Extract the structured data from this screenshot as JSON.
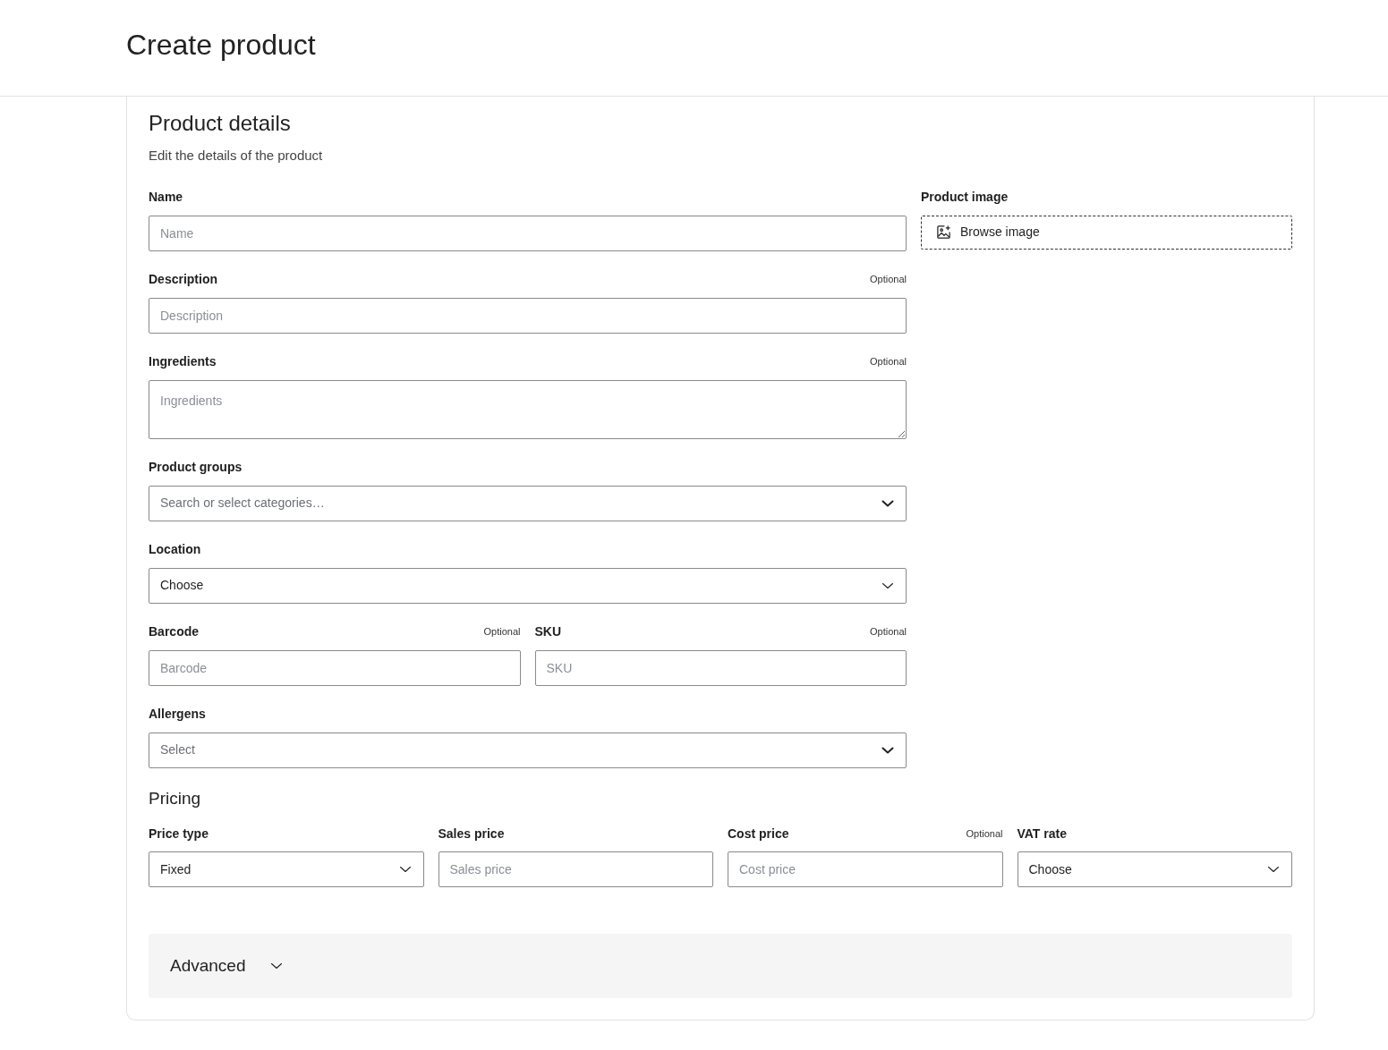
{
  "page": {
    "title": "Create product"
  },
  "section": {
    "title": "Product details",
    "subtitle": "Edit the details of the product"
  },
  "fields": [
    {
      "kind": "text",
      "label": "Name",
      "placeholder": "Name"
    },
    {
      "kind": "text",
      "label": "Description",
      "optional": "Optional",
      "placeholder": "Description"
    },
    {
      "kind": "textarea",
      "label": "Ingredients",
      "optional": "Optional",
      "placeholder": "Ingredients"
    },
    {
      "kind": "combobox",
      "label": "Product groups",
      "placeholder": "Search or select categories…"
    },
    {
      "kind": "select",
      "label": "Location",
      "value": "Choose"
    },
    {
      "kind": "pair",
      "items": [
        {
          "kind": "text",
          "label": "Barcode",
          "optional": "Optional",
          "placeholder": "Barcode"
        },
        {
          "kind": "text",
          "label": "SKU",
          "optional": "Optional",
          "placeholder": "SKU"
        }
      ]
    },
    {
      "kind": "combobox",
      "label": "Allergens",
      "placeholder": "Select"
    }
  ],
  "product_image": {
    "label": "Product image",
    "button": "Browse image"
  },
  "pricing": {
    "title": "Pricing",
    "fields": [
      {
        "kind": "select",
        "label": "Price type",
        "value": "Fixed"
      },
      {
        "kind": "text",
        "label": "Sales price",
        "placeholder": "Sales price"
      },
      {
        "kind": "text",
        "label": "Cost price",
        "optional": "Optional",
        "placeholder": "Cost price"
      },
      {
        "kind": "select",
        "label": "VAT rate",
        "value": "Choose"
      }
    ]
  },
  "advanced": {
    "label": "Advanced",
    "expanded": false
  }
}
